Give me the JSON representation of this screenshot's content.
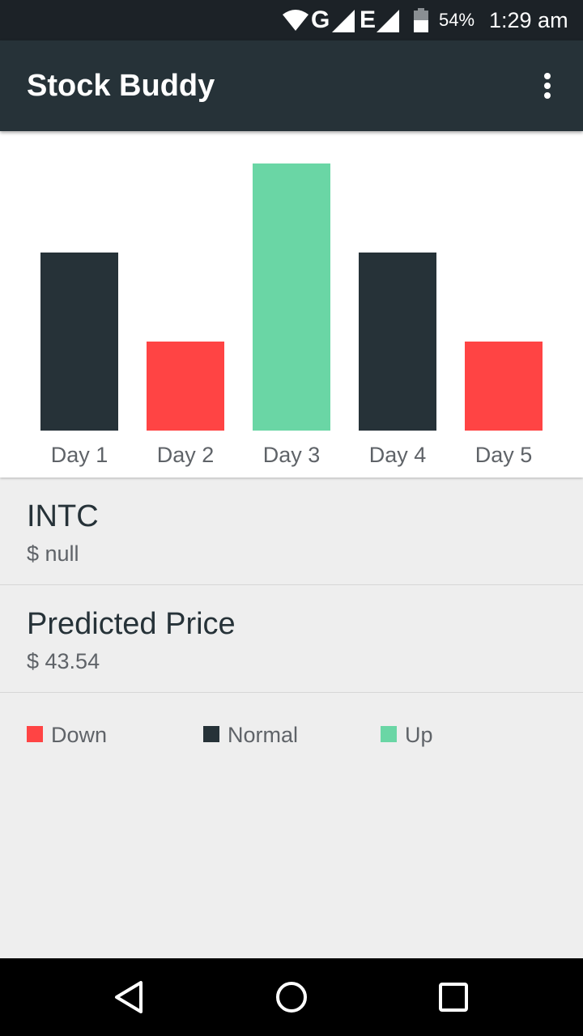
{
  "status_bar": {
    "network_1": "G",
    "network_2": "E",
    "battery": "54%",
    "time": "1:29 am",
    "background": "#1C2227"
  },
  "app_bar": {
    "title": "Stock Buddy",
    "background": "#263238",
    "overflow_icon": "more-vert-icon"
  },
  "chart_data": {
    "type": "bar",
    "categories": [
      "Day 1",
      "Day 2",
      "Day 3",
      "Day 4",
      "Day 5"
    ],
    "values": [
      2,
      1,
      3,
      2,
      1
    ],
    "statuses": [
      "Normal",
      "Down",
      "Up",
      "Normal",
      "Down"
    ],
    "ylim": [
      0,
      3
    ],
    "grid": false,
    "title": "",
    "xlabel": "",
    "ylabel": ""
  },
  "colors": {
    "Down": "#FF4444",
    "Normal": "#263238",
    "Up": "#6AD6A5",
    "axis_label": "#5F6368"
  },
  "stock": {
    "symbol": "INTC",
    "price": "$ null"
  },
  "prediction": {
    "title": "Predicted Price",
    "price": "$ 43.54"
  },
  "legend": [
    {
      "label": "Down",
      "status": "Down"
    },
    {
      "label": "Normal",
      "status": "Normal"
    },
    {
      "label": "Up",
      "status": "Up"
    }
  ],
  "nav_bar": {
    "back_icon": "back-icon",
    "home_icon": "home-icon",
    "recents_icon": "recents-icon"
  }
}
